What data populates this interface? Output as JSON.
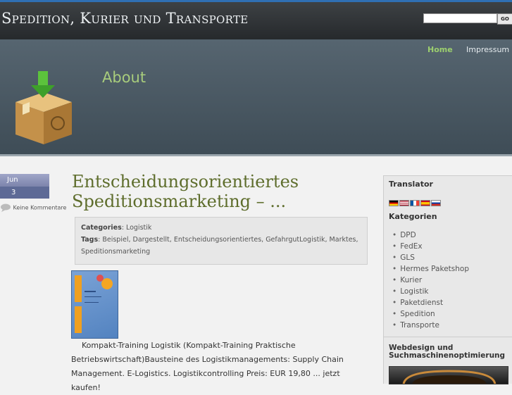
{
  "site": {
    "title": "Spedition, Kurier und Transporte"
  },
  "search": {
    "placeholder": "",
    "button_label": "GO"
  },
  "nav": {
    "home": "Home",
    "impressum": "Impressum"
  },
  "header": {
    "page_title": "About"
  },
  "post": {
    "date_month": "Jun",
    "date_day": "3",
    "comments": "Keine Kommentare",
    "title": "Entscheidungsorientiertes Speditionsmarketing – ...",
    "categories_label": "Categories",
    "categories_value": "Logistik",
    "tags_label": "Tags",
    "tags_value": "Beispiel, Dargestellt, Entscheidungsorientiertes, GefahrgutLogistik, Marktes, Speditionsmarketing",
    "text_line1": "Kompakt-Training Logistik (Kompakt-Training Praktische",
    "text_line2": "Betriebswirtschaft)Bausteine des Logistikmanagements: Supply Chain",
    "text_line3": "Management. E-Logistics. Logistikcontrolling Preis: EUR 19,80 ... jetzt kaufen!"
  },
  "sidebar": {
    "translator_title": "Translator",
    "kategorien_title": "Kategorien",
    "categories": [
      "DPD",
      "FedEx",
      "GLS",
      "Hermes Paketshop",
      "Kurier",
      "Logistik",
      "Paketdienst",
      "Spedition",
      "Transporte"
    ],
    "webdesign_line1": "Webdesign und",
    "webdesign_line2": "Suchmaschinenoptimierung"
  },
  "colors": {
    "accent_green": "#9ccf6e",
    "title_olive": "#5e6d2c",
    "topbar_blue": "#2f6fb3"
  }
}
